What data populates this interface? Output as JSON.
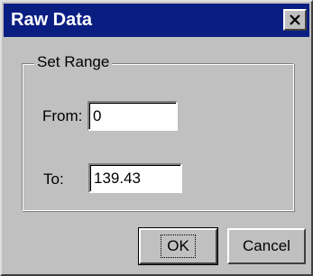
{
  "window": {
    "title": "Raw Data",
    "close_icon": "close-icon"
  },
  "group": {
    "legend": "Set Range"
  },
  "fields": {
    "from_label": "From:",
    "from_value": "0",
    "to_label": "To:",
    "to_value": "139.43"
  },
  "buttons": {
    "ok_label": "OK",
    "cancel_label": "Cancel"
  },
  "colors": {
    "titlebar": "#0a1e82",
    "face": "#c0c0c0"
  }
}
